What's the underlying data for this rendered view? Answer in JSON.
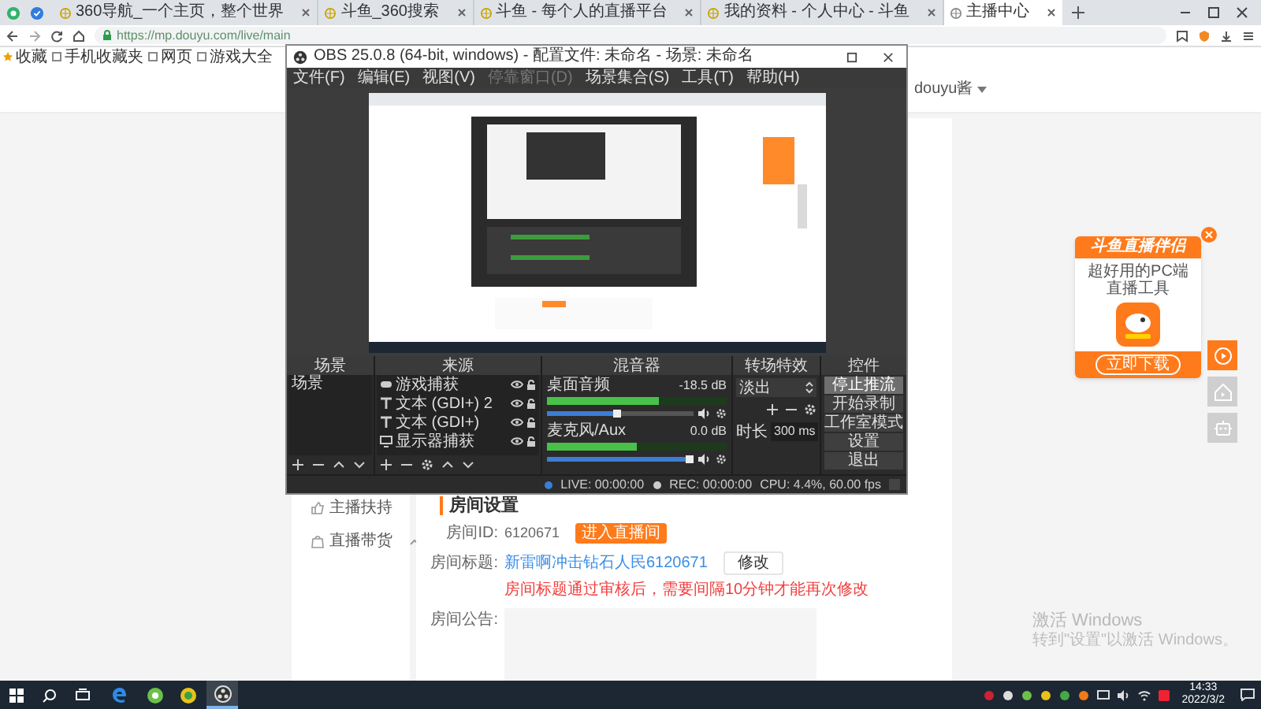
{
  "browser": {
    "tabs": [
      {
        "label": "360导航_一个主页，整个世界",
        "selected": false
      },
      {
        "label": "斗鱼_360搜索",
        "selected": false
      },
      {
        "label": "斗鱼 - 每个人的直播平台",
        "selected": false
      },
      {
        "label": "我的资料 - 个人中心 - 斗鱼",
        "selected": false
      },
      {
        "label": "主播中心",
        "selected": true
      }
    ],
    "url": "https://mp.douyu.com/live/main",
    "bookmarks": [
      "收藏",
      "手机收藏夹",
      "网页",
      "游戏大全"
    ]
  },
  "page": {
    "user": "douyu酱",
    "sidebar": [
      {
        "label": "主播扶持",
        "kind": "link"
      },
      {
        "label": "直播带货",
        "kind": "group",
        "expanded": true
      }
    ],
    "room": {
      "heading": "房间设置",
      "id_label": "房间ID:",
      "id_value": "6120671",
      "enter_button": "进入直播间",
      "title_label": "房间标题:",
      "title_value": "新雷啊冲击钻石人民6120671",
      "edit_button": "修改",
      "notice": "房间标题通过审核后，需要间隔10分钟才能再次修改",
      "announcement_label": "房间公告:"
    }
  },
  "ad": {
    "title": "斗鱼直播伴侣",
    "subtitle": "超好用的PC端直播工具",
    "button": "立即下载"
  },
  "windows_notice": {
    "title": "激活 Windows",
    "hint": "转到\"设置\"以激活 Windows。"
  },
  "obs": {
    "title": "OBS 25.0.8 (64-bit, windows) - 配置文件: 未命名 - 场景: 未命名",
    "menu": [
      {
        "label": "文件(F)",
        "disabled": false
      },
      {
        "label": "编辑(E)",
        "disabled": false
      },
      {
        "label": "视图(V)",
        "disabled": false
      },
      {
        "label": "停靠窗口(D)",
        "disabled": true
      },
      {
        "label": "场景集合(S)",
        "disabled": false
      },
      {
        "label": "工具(T)",
        "disabled": false
      },
      {
        "label": "帮助(H)",
        "disabled": false
      }
    ],
    "scenes": {
      "title": "场景",
      "items": [
        "场景"
      ]
    },
    "sources": {
      "title": "来源",
      "items": [
        {
          "label": "游戏捕获",
          "kind": "game"
        },
        {
          "label": "文本 (GDI+) 2",
          "kind": "text"
        },
        {
          "label": "文本 (GDI+)",
          "kind": "text"
        },
        {
          "label": "显示器捕获",
          "kind": "monitor"
        }
      ]
    },
    "mixer": {
      "title": "混音器",
      "channels": [
        {
          "name": "桌面音频",
          "reading": "-18.5 dB",
          "meter": {
            "level": 0.62
          },
          "level": 0.45
        },
        {
          "name": "麦克风/Aux",
          "reading": "0.0 dB",
          "meter": {
            "level": 0.5
          },
          "level": 1.0
        }
      ]
    },
    "transitions": {
      "title": "转场特效",
      "value": "淡出",
      "duration_label": "时长",
      "duration": "300 ms"
    },
    "controls": {
      "title": "控件",
      "buttons": [
        {
          "label": "停止推流",
          "active": true
        },
        {
          "label": "开始录制",
          "active": false
        },
        {
          "label": "工作室模式",
          "active": false
        },
        {
          "label": "设置",
          "active": false
        },
        {
          "label": "退出",
          "active": false
        }
      ]
    },
    "status": {
      "live": "LIVE: 00:00:00",
      "rec": "REC: 00:00:00",
      "cpu": "CPU: 4.4%, 60.00 fps"
    }
  },
  "taskbar": {
    "time": "14:33",
    "date": "2022/3/2"
  }
}
